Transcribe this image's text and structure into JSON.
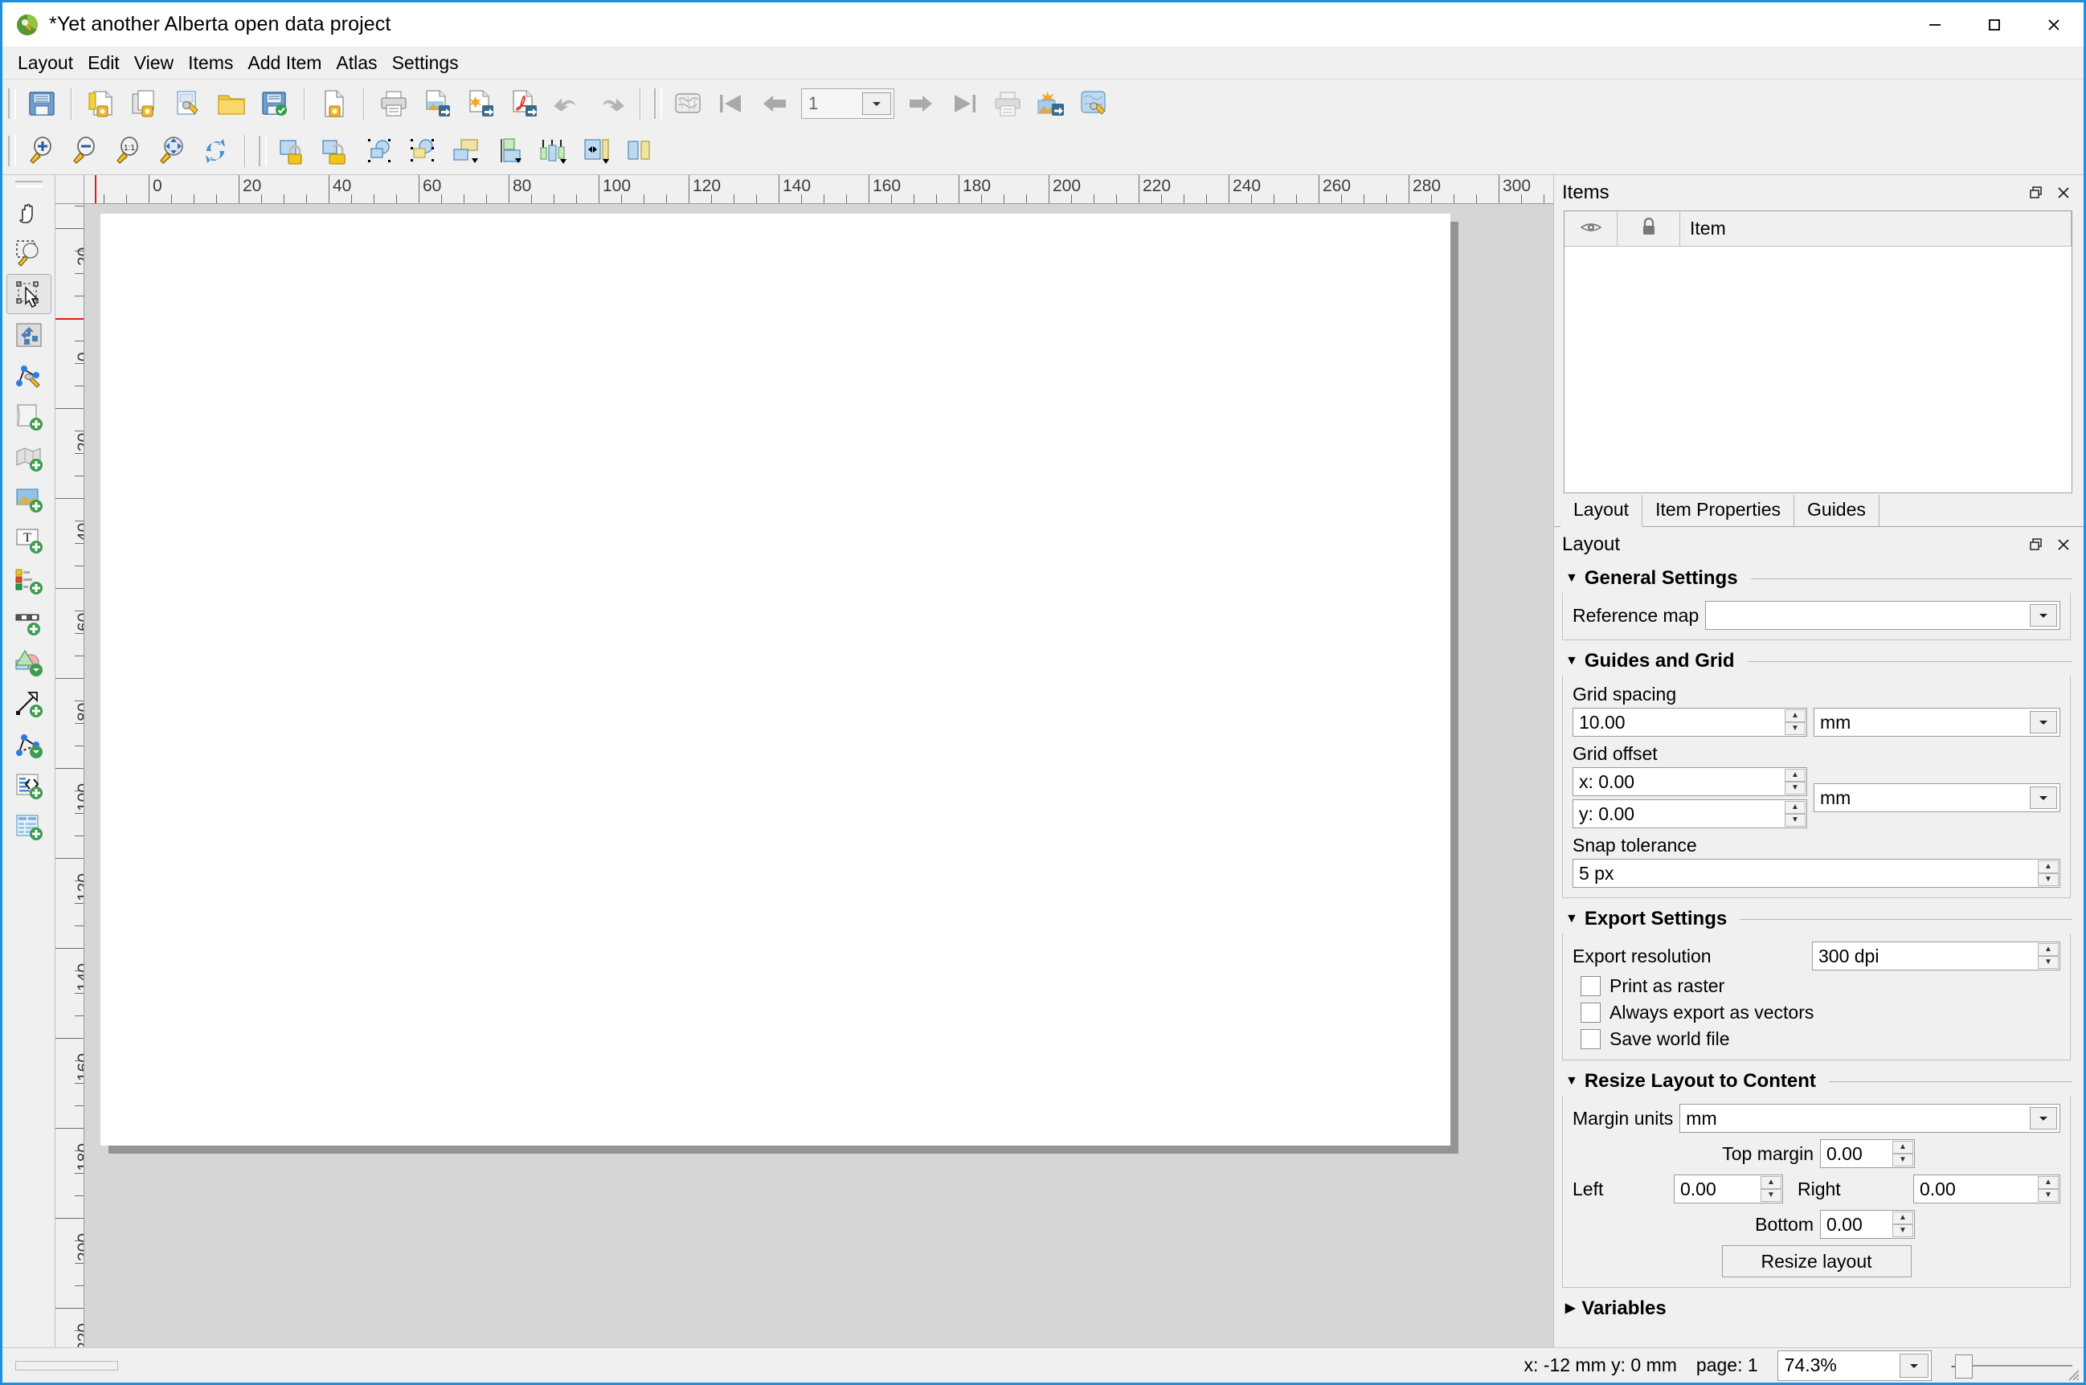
{
  "window": {
    "title": "*Yet another Alberta open data project",
    "logo_icon": "qgis-logo-icon",
    "minimize_label": "—",
    "maximize_label": "❑",
    "close_label": "✕"
  },
  "menubar": {
    "items": [
      {
        "label": "Layout"
      },
      {
        "label": "Edit"
      },
      {
        "label": "View"
      },
      {
        "label": "Items"
      },
      {
        "label": "Add Item"
      },
      {
        "label": "Atlas"
      },
      {
        "label": "Settings"
      }
    ]
  },
  "toolbar_row1": {
    "groups": [
      {
        "buttons": [
          {
            "name": "save-project-icon",
            "title": "Save Project"
          }
        ]
      },
      {
        "buttons": [
          {
            "name": "new-layout-icon",
            "title": "New Layout"
          },
          {
            "name": "duplicate-layout-icon",
            "title": "Duplicate Layout"
          },
          {
            "name": "layout-manager-icon",
            "title": "Layout Manager"
          },
          {
            "name": "open-folder-icon",
            "title": "Add Items from Template"
          },
          {
            "name": "save-as-template-icon",
            "title": "Save as Template"
          }
        ]
      },
      {
        "buttons": [
          {
            "name": "layout-properties-icon",
            "title": "Layout Properties"
          }
        ]
      },
      {
        "buttons": [
          {
            "name": "print-icon",
            "title": "Print Layout"
          },
          {
            "name": "export-image-icon",
            "title": "Export as Image"
          },
          {
            "name": "export-svg-icon",
            "title": "Export as SVG"
          },
          {
            "name": "export-pdf-icon",
            "title": "Export as PDF"
          },
          {
            "name": "undo-icon",
            "title": "Undo"
          },
          {
            "name": "redo-icon",
            "title": "Redo"
          }
        ]
      },
      {
        "buttons": [
          {
            "name": "atlas-settings-icon",
            "title": "Atlas Settings"
          },
          {
            "name": "atlas-first-feature-icon",
            "title": "First Feature"
          },
          {
            "name": "atlas-prev-feature-icon",
            "title": "Previous Feature"
          }
        ]
      },
      {
        "buttons": [
          {
            "name": "atlas-next-feature-icon",
            "title": "Next Feature"
          },
          {
            "name": "atlas-last-feature-icon",
            "title": "Last Feature"
          },
          {
            "name": "atlas-print-icon",
            "title": "Print Atlas"
          },
          {
            "name": "atlas-export-image-icon",
            "title": "Export Atlas as Image"
          },
          {
            "name": "atlas-preview-icon",
            "title": "Preview Atlas"
          }
        ]
      }
    ],
    "atlas_page_value": "1"
  },
  "toolbar_row2": {
    "zoom_buttons": [
      {
        "name": "zoom-in-icon",
        "title": "Zoom In"
      },
      {
        "name": "zoom-out-icon",
        "title": "Zoom Out"
      },
      {
        "name": "zoom-100-icon",
        "title": "Zoom 100%"
      },
      {
        "name": "zoom-full-icon",
        "title": "Zoom Full"
      },
      {
        "name": "refresh-icon",
        "title": "Refresh View"
      }
    ],
    "item_buttons": [
      {
        "name": "lock-items-icon",
        "title": "Lock Selected Items"
      },
      {
        "name": "unlock-items-icon",
        "title": "Unlock All Items"
      },
      {
        "name": "group-items-icon",
        "title": "Group Items"
      },
      {
        "name": "ungroup-items-icon",
        "title": "Ungroup Items"
      },
      {
        "name": "raise-items-icon",
        "title": "Raise Selected Items"
      },
      {
        "name": "lower-items-icon",
        "title": "Lower Selected Items"
      },
      {
        "name": "align-items-icon",
        "title": "Align Selected Items"
      },
      {
        "name": "distribute-items-icon",
        "title": "Distribute Selected Items"
      },
      {
        "name": "resize-items-icon",
        "title": "Resize Selected Items"
      }
    ]
  },
  "vtoolbar": {
    "buttons": [
      {
        "name": "pan-layout-icon",
        "title": "Pan Layout",
        "active": false
      },
      {
        "name": "zoom-tool-icon",
        "title": "Zoom",
        "active": false
      },
      {
        "name": "select-move-item-icon",
        "title": "Select/Move Item",
        "active": true
      },
      {
        "name": "move-item-content-icon",
        "title": "Move Item Content",
        "active": false
      },
      {
        "name": "edit-nodes-icon",
        "title": "Edit Nodes Item",
        "active": false
      },
      {
        "name": "add-page-icon",
        "title": "Add Pages to Layout",
        "active": false
      },
      {
        "name": "add-map-icon",
        "title": "Add Map",
        "active": false
      },
      {
        "name": "add-picture-icon",
        "title": "Add Picture",
        "active": false
      },
      {
        "name": "add-label-icon",
        "title": "Add Label",
        "active": false
      },
      {
        "name": "add-legend-icon",
        "title": "Add Legend",
        "active": false
      },
      {
        "name": "add-scalebar-icon",
        "title": "Add Scale Bar",
        "active": false
      },
      {
        "name": "add-shape-icon",
        "title": "Add Shape",
        "active": false
      },
      {
        "name": "add-arrow-icon",
        "title": "Add Arrow",
        "active": false
      },
      {
        "name": "add-node-item-icon",
        "title": "Add Node Item",
        "active": false
      },
      {
        "name": "add-html-icon",
        "title": "Add HTML Frame",
        "active": false
      },
      {
        "name": "add-table-icon",
        "title": "Add Attribute Table",
        "active": false
      }
    ]
  },
  "rulers": {
    "units": "mm",
    "h_labels": [
      "0",
      "20",
      "40",
      "60",
      "80",
      "100",
      "120",
      "140",
      "160",
      "180",
      "200",
      "220",
      "240",
      "260",
      "280",
      "300"
    ],
    "v_labels": [
      "-20",
      "0",
      "20",
      "40",
      "60",
      "80",
      "100",
      "120",
      "140",
      "160",
      "180",
      "200",
      "220"
    ]
  },
  "items_panel": {
    "title": "Items",
    "float_icon": "restore-icon",
    "close_icon": "close-icon",
    "columns": [
      {
        "name": "visibility-column",
        "icon": "eye-icon",
        "label": ""
      },
      {
        "name": "lock-column",
        "icon": "lock-icon",
        "label": ""
      },
      {
        "name": "item-column",
        "icon": "",
        "label": "Item"
      }
    ],
    "rows": []
  },
  "tabs": [
    {
      "label": "Layout",
      "active": true
    },
    {
      "label": "Item Properties",
      "active": false
    },
    {
      "label": "Guides",
      "active": false
    }
  ],
  "layout_panel": {
    "title": "Layout",
    "float_icon": "restore-icon",
    "close_icon": "close-icon",
    "general_settings": {
      "heading": "General Settings",
      "expanded": true,
      "reference_map_label": "Reference map",
      "reference_map_value": ""
    },
    "guides_and_grid": {
      "heading": "Guides and Grid",
      "expanded": true,
      "grid_spacing_label": "Grid spacing",
      "grid_spacing_value": "10.00",
      "grid_spacing_units": "mm",
      "grid_offset_label": "Grid offset",
      "grid_offset_x_value": "x: 0.00",
      "grid_offset_y_value": "y: 0.00",
      "grid_offset_units": "mm",
      "snap_tolerance_label": "Snap tolerance",
      "snap_tolerance_value": "5 px"
    },
    "export_settings": {
      "heading": "Export Settings",
      "expanded": true,
      "export_resolution_label": "Export resolution",
      "export_resolution_value": "300 dpi",
      "checkboxes": [
        {
          "label": "Print as raster",
          "checked": false
        },
        {
          "label": "Always export as vectors",
          "checked": false
        },
        {
          "label": "Save world file",
          "checked": false
        }
      ]
    },
    "resize_layout": {
      "heading": "Resize Layout to Content",
      "expanded": true,
      "margin_units_label": "Margin units",
      "margin_units_value": "mm",
      "top_label": "Top margin",
      "top_value": "0.00",
      "left_label": "Left",
      "left_value": "0.00",
      "right_label": "Right",
      "right_value": "0.00",
      "bottom_label": "Bottom",
      "bottom_value": "0.00",
      "button_label": "Resize layout"
    },
    "variables": {
      "heading": "Variables",
      "expanded": false
    }
  },
  "statusbar": {
    "coordinates": "x: -12 mm  y: 0 mm",
    "page": "page: 1",
    "zoom_value": "74.3%",
    "zoom_minus": "-"
  },
  "colors": {
    "accent": "#1b8fe0",
    "canvas_bg": "#d6d6d6",
    "page_bg": "#ffffff",
    "page_shadow": "#949494",
    "chrome": "#f0f0f0"
  }
}
